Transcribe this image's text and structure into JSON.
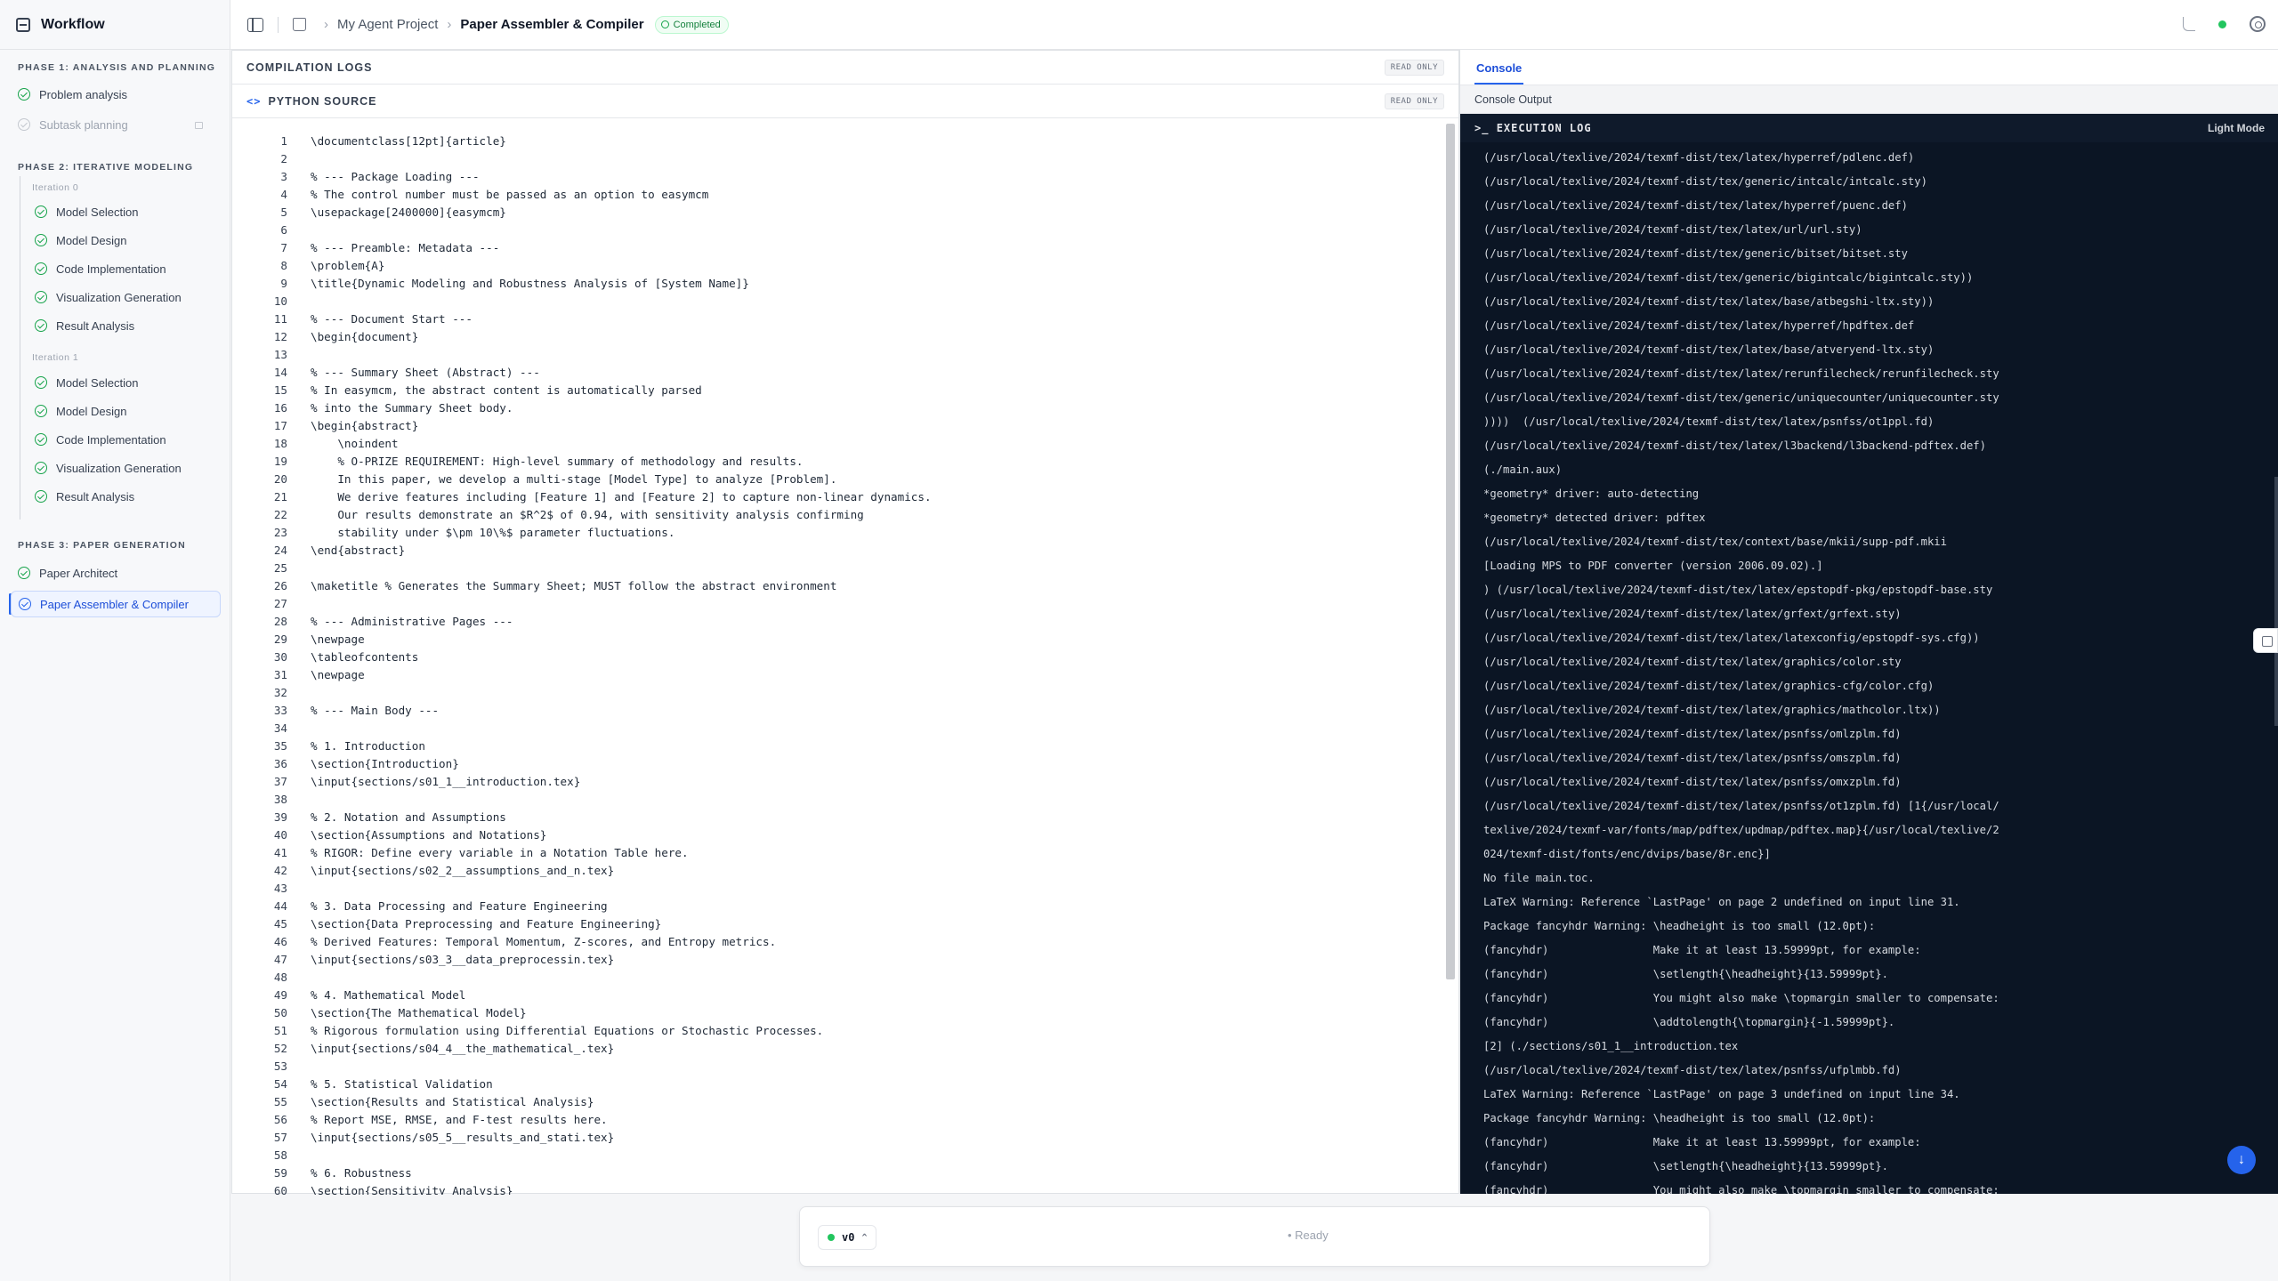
{
  "sidebar": {
    "title": "Workflow",
    "phase1": "PHASE 1: ANALYSIS AND PLANNING",
    "phase1_items": [
      "Problem analysis",
      "Subtask planning"
    ],
    "phase2": "PHASE 2: ITERATIVE MODELING",
    "iter0": "Iteration 0",
    "iter0_items": [
      "Model Selection",
      "Model Design",
      "Code Implementation",
      "Visualization Generation",
      "Result Analysis"
    ],
    "iter1": "Iteration 1",
    "iter1_items": [
      "Model Selection",
      "Model Design",
      "Code Implementation",
      "Visualization Generation",
      "Result Analysis"
    ],
    "phase3": "PHASE 3: PAPER GENERATION",
    "phase3_items": [
      "Paper Architect",
      "Paper Assembler & Compiler"
    ]
  },
  "topbar": {
    "project": "My Agent Project",
    "page": "Paper Assembler & Compiler",
    "status": "Completed"
  },
  "left": {
    "compilation_title": "COMPILATION LOGS",
    "read_only": "READ ONLY",
    "source_icon": "<>",
    "source_title": "PYTHON SOURCE",
    "code": [
      "\\documentclass[12pt]{article}",
      "",
      "% --- Package Loading ---",
      "% The control number must be passed as an option to easymcm",
      "\\usepackage[2400000]{easymcm}",
      "",
      "% --- Preamble: Metadata ---",
      "\\problem{A}",
      "\\title{Dynamic Modeling and Robustness Analysis of [System Name]}",
      "",
      "% --- Document Start ---",
      "\\begin{document}",
      "",
      "% --- Summary Sheet (Abstract) ---",
      "% In easymcm, the abstract content is automatically parsed",
      "% into the Summary Sheet body.",
      "\\begin{abstract}",
      "    \\noindent",
      "    % O-PRIZE REQUIREMENT: High-level summary of methodology and results.",
      "    In this paper, we develop a multi-stage [Model Type] to analyze [Problem].",
      "    We derive features including [Feature 1] and [Feature 2] to capture non-linear dynamics.",
      "    Our results demonstrate an $R^2$ of 0.94, with sensitivity analysis confirming",
      "    stability under $\\pm 10\\%$ parameter fluctuations.",
      "\\end{abstract}",
      "",
      "\\maketitle % Generates the Summary Sheet; MUST follow the abstract environment",
      "",
      "% --- Administrative Pages ---",
      "\\newpage",
      "\\tableofcontents",
      "\\newpage",
      "",
      "% --- Main Body ---",
      "",
      "% 1. Introduction",
      "\\section{Introduction}",
      "\\input{sections/s01_1__introduction.tex}",
      "",
      "% 2. Notation and Assumptions",
      "\\section{Assumptions and Notations}",
      "% RIGOR: Define every variable in a Notation Table here.",
      "\\input{sections/s02_2__assumptions_and_n.tex}",
      "",
      "% 3. Data Processing and Feature Engineering",
      "\\section{Data Preprocessing and Feature Engineering}",
      "% Derived Features: Temporal Momentum, Z-scores, and Entropy metrics.",
      "\\input{sections/s03_3__data_preprocessin.tex}",
      "",
      "% 4. Mathematical Model",
      "\\section{The Mathematical Model}",
      "% Rigorous formulation using Differential Equations or Stochastic Processes.",
      "\\input{sections/s04_4__the_mathematical_.tex}",
      "",
      "% 5. Statistical Validation",
      "\\section{Results and Statistical Analysis}",
      "% Report MSE, RMSE, and F-test results here.",
      "\\input{sections/s05_5__results_and_stati.tex}",
      "",
      "% 6. Robustness",
      "\\section{Sensitivity Analysis}"
    ]
  },
  "console": {
    "tab": "Console",
    "sub": "Console Output",
    "log_title": "EXECUTION LOG",
    "mode": "Light Mode",
    "log": [
      "(/usr/local/texlive/2024/texmf-dist/tex/latex/hyperref/pdlenc.def)",
      "(/usr/local/texlive/2024/texmf-dist/tex/generic/intcalc/intcalc.sty)",
      "(/usr/local/texlive/2024/texmf-dist/tex/latex/hyperref/puenc.def)",
      "(/usr/local/texlive/2024/texmf-dist/tex/latex/url/url.sty)",
      "(/usr/local/texlive/2024/texmf-dist/tex/generic/bitset/bitset.sty",
      "(/usr/local/texlive/2024/texmf-dist/tex/generic/bigintcalc/bigintcalc.sty))",
      "(/usr/local/texlive/2024/texmf-dist/tex/latex/base/atbegshi-ltx.sty))",
      "(/usr/local/texlive/2024/texmf-dist/tex/latex/hyperref/hpdftex.def",
      "(/usr/local/texlive/2024/texmf-dist/tex/latex/base/atveryend-ltx.sty)",
      "(/usr/local/texlive/2024/texmf-dist/tex/latex/rerunfilecheck/rerunfilecheck.sty",
      "(/usr/local/texlive/2024/texmf-dist/tex/generic/uniquecounter/uniquecounter.sty",
      "))))  (/usr/local/texlive/2024/texmf-dist/tex/latex/psnfss/ot1ppl.fd)",
      "(/usr/local/texlive/2024/texmf-dist/tex/latex/l3backend/l3backend-pdftex.def)",
      "(./main.aux)",
      "*geometry* driver: auto-detecting",
      "*geometry* detected driver: pdftex",
      "(/usr/local/texlive/2024/texmf-dist/tex/context/base/mkii/supp-pdf.mkii",
      "[Loading MPS to PDF converter (version 2006.09.02).]",
      ") (/usr/local/texlive/2024/texmf-dist/tex/latex/epstopdf-pkg/epstopdf-base.sty",
      "(/usr/local/texlive/2024/texmf-dist/tex/latex/grfext/grfext.sty)",
      "(/usr/local/texlive/2024/texmf-dist/tex/latex/latexconfig/epstopdf-sys.cfg))",
      "(/usr/local/texlive/2024/texmf-dist/tex/latex/graphics/color.sty",
      "(/usr/local/texlive/2024/texmf-dist/tex/latex/graphics-cfg/color.cfg)",
      "(/usr/local/texlive/2024/texmf-dist/tex/latex/graphics/mathcolor.ltx))",
      "(/usr/local/texlive/2024/texmf-dist/tex/latex/psnfss/omlzplm.fd)",
      "(/usr/local/texlive/2024/texmf-dist/tex/latex/psnfss/omszplm.fd)",
      "(/usr/local/texlive/2024/texmf-dist/tex/latex/psnfss/omxzplm.fd)",
      "(/usr/local/texlive/2024/texmf-dist/tex/latex/psnfss/ot1zplm.fd) [1{/usr/local/",
      "texlive/2024/texmf-var/fonts/map/pdftex/updmap/pdftex.map}{/usr/local/texlive/2",
      "024/texmf-dist/fonts/enc/dvips/base/8r.enc}]",
      "No file main.toc.",
      "LaTeX Warning: Reference `LastPage' on page 2 undefined on input line 31.",
      "Package fancyhdr Warning: \\headheight is too small (12.0pt):",
      "(fancyhdr)                Make it at least 13.59999pt, for example:",
      "(fancyhdr)                \\setlength{\\headheight}{13.59999pt}.",
      "(fancyhdr)                You might also make \\topmargin smaller to compensate:",
      "(fancyhdr)                \\addtolength{\\topmargin}{-1.59999pt}.",
      "[2] (./sections/s01_1__introduction.tex",
      "(/usr/local/texlive/2024/texmf-dist/tex/latex/psnfss/ufplmbb.fd)",
      "LaTeX Warning: Reference `LastPage' on page 3 undefined on input line 34.",
      "Package fancyhdr Warning: \\headheight is too small (12.0pt):",
      "(fancyhdr)                Make it at least 13.59999pt, for example:",
      "(fancyhdr)                \\setlength{\\headheight}{13.59999pt}.",
      "(fancyhdr)                You might also make \\topmargin smaller to compensate:"
    ]
  },
  "bottom": {
    "version": "v0",
    "status": "Ready"
  },
  "colors": {
    "accent": "#2563eb",
    "success": "#16a34a",
    "console_bg": "#0b1524"
  }
}
